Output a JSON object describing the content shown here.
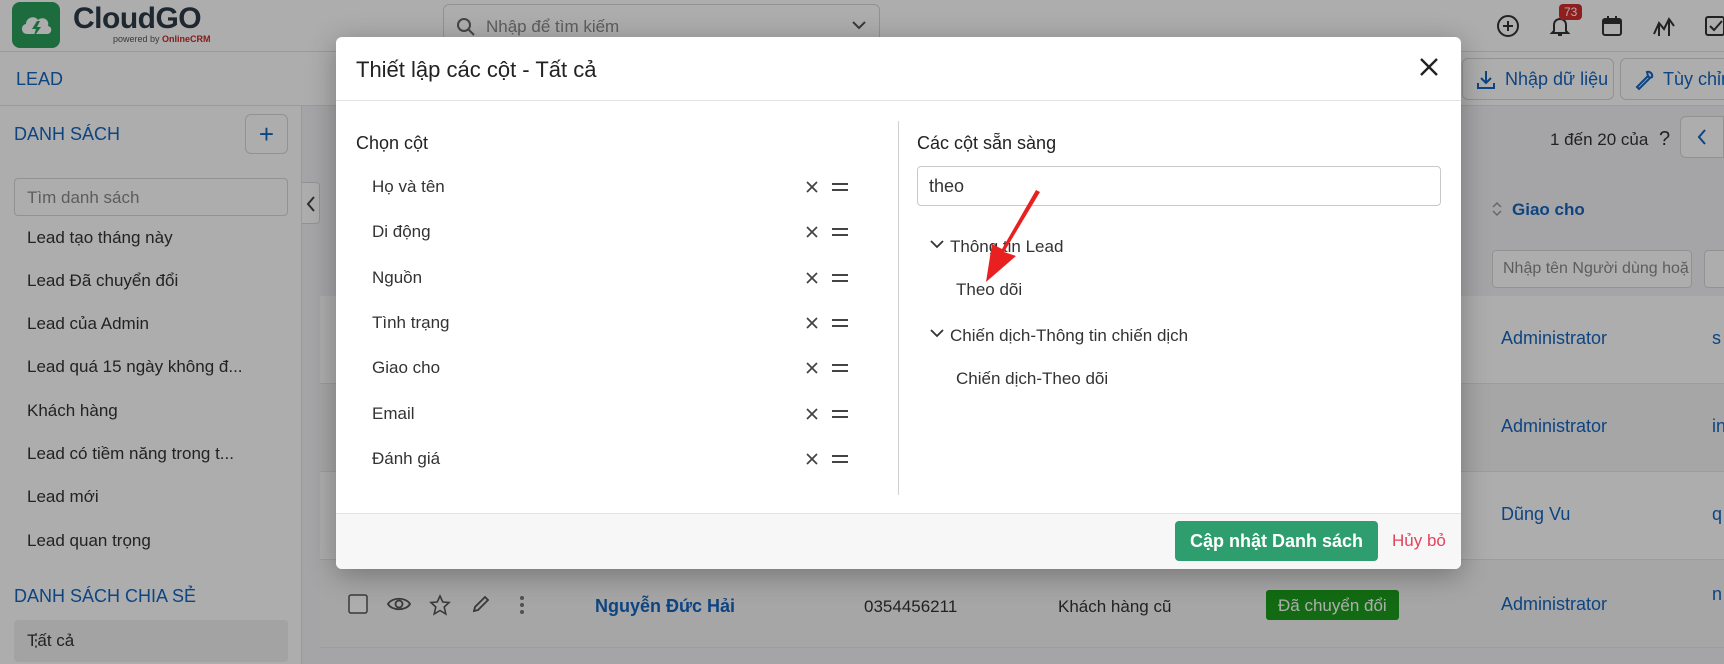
{
  "app": {
    "logo_text": "CloudGO",
    "logo_sub_prefix": "powered by ",
    "logo_sub_brand": "OnlineCRM",
    "search_placeholder": "Nhập để tìm kiếm",
    "notification_count": "73"
  },
  "module": {
    "title": "LEAD",
    "import_label": "Nhập dữ liệu",
    "customize_label": "Tùy chỉn"
  },
  "sidebar": {
    "list_heading": "DANH SÁCH",
    "add_label": "+",
    "search_placeholder": "Tìm danh sách",
    "items": [
      "Lead tạo tháng này",
      "Lead Đã chuyển đổi",
      "Lead của Admin",
      "Lead quá 15 ngày không đ...",
      "Khách hàng",
      "Lead có tiềm năng trong t...",
      "Lead mới",
      "Lead quan trọng"
    ],
    "shared_heading": "DANH SÁCH CHIA SẺ",
    "active_item": "Tất cả"
  },
  "list": {
    "pager": "1 đến 20 của",
    "pager_help": "?",
    "assigned_header": "Giao cho",
    "assigned_filter_placeholder": "Nhập tên Người dùng hoặ",
    "rows": [
      {
        "assigned": "Administrator",
        "extra": "s"
      },
      {
        "assigned": "Administrator",
        "extra": "in"
      },
      {
        "assigned": "Dũng Vu",
        "extra": "q"
      },
      {
        "name": "Nguyễn Đức Hải",
        "phone": "0354456211",
        "source": "Khách hàng cũ",
        "status": "Đã chuyển đổi",
        "assigned": "Administrator",
        "extra": "n"
      }
    ]
  },
  "modal": {
    "title": "Thiết lập các cột - Tất cả",
    "selected_heading": "Chọn cột",
    "selected_columns": [
      "Họ và tên",
      "Di động",
      "Nguồn",
      "Tình trạng",
      "Giao cho",
      "Email",
      "Đánh giá"
    ],
    "available_heading": "Các cột sẵn sàng",
    "available_search_value": "theo",
    "groups": [
      {
        "label": "Thông tin Lead",
        "options": [
          "Theo dõi"
        ]
      },
      {
        "label": "Chiến dịch-Thông tin chiến dịch",
        "options": [
          "Chiến dịch-Theo dõi"
        ]
      }
    ],
    "update_button": "Cập nhật Danh sách",
    "cancel_button": "Hủy bỏ"
  },
  "colors": {
    "brand_green": "#2aa05a",
    "primary_button": "#2e9e6e",
    "link_blue": "#1565c0",
    "cancel_red": "#e0445b",
    "status_green": "#1b9e1b",
    "annotation_arrow": "#e82020"
  }
}
